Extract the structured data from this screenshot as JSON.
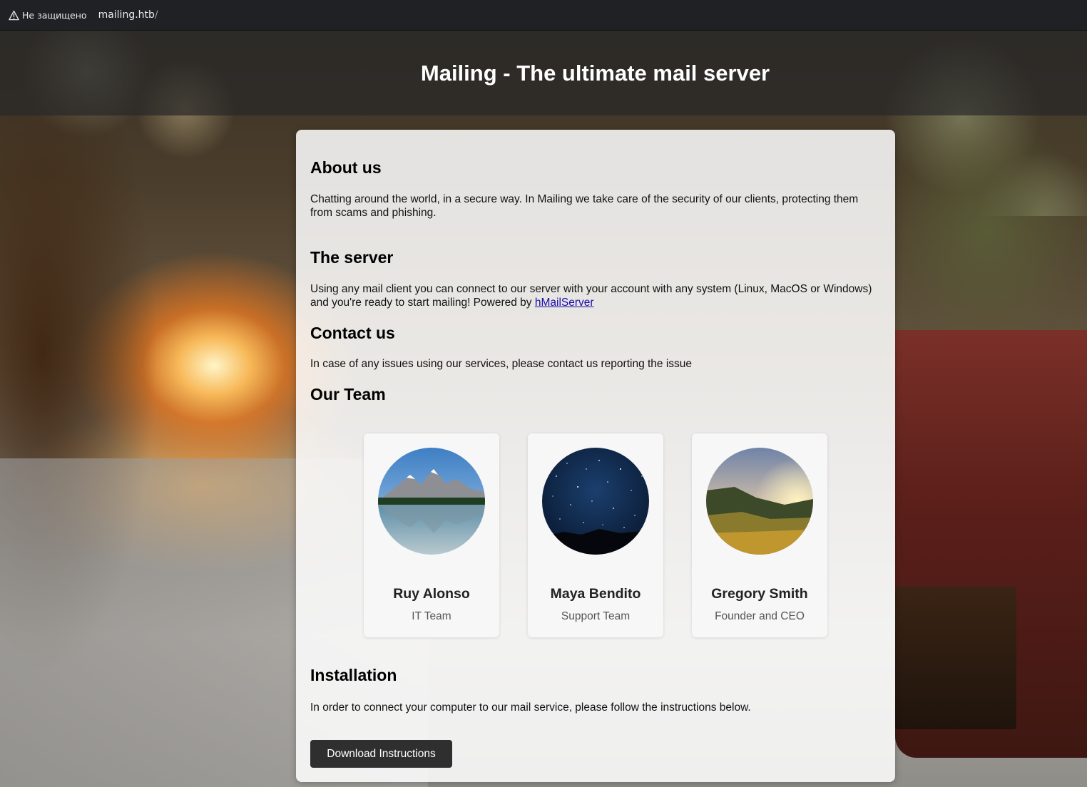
{
  "browser": {
    "security_text": "Не защищено",
    "url_host": "mailing.htb",
    "url_path": "/"
  },
  "header": {
    "title": "Mailing - The ultimate mail server"
  },
  "about": {
    "heading": "About us",
    "text": "Chatting around the world, in a secure way. In Mailing we take care of the security of our clients, protecting them from scams and phishing."
  },
  "server": {
    "heading": "The server",
    "text": "Using any mail client you can connect to our server with your account with any system (Linux, MacOS or Windows) and you're ready to start mailing! Powered by ",
    "link_text": "hMailServer"
  },
  "contact": {
    "heading": "Contact us",
    "text": "In case of any issues using our services, please contact us reporting the issue"
  },
  "team": {
    "heading": "Our Team",
    "members": [
      {
        "name": "Ruy Alonso",
        "role": "IT Team"
      },
      {
        "name": "Maya Bendito",
        "role": "Support Team"
      },
      {
        "name": "Gregory Smith",
        "role": "Founder and CEO"
      }
    ]
  },
  "installation": {
    "heading": "Installation",
    "text": "In order to connect your computer to our mail service, please follow the instructions below.",
    "button_label": "Download Instructions"
  },
  "colors": {
    "header_band": "#282828",
    "card_bg": "#ffffff",
    "button_bg": "#2f2f2f",
    "link": "#1a0dab"
  }
}
